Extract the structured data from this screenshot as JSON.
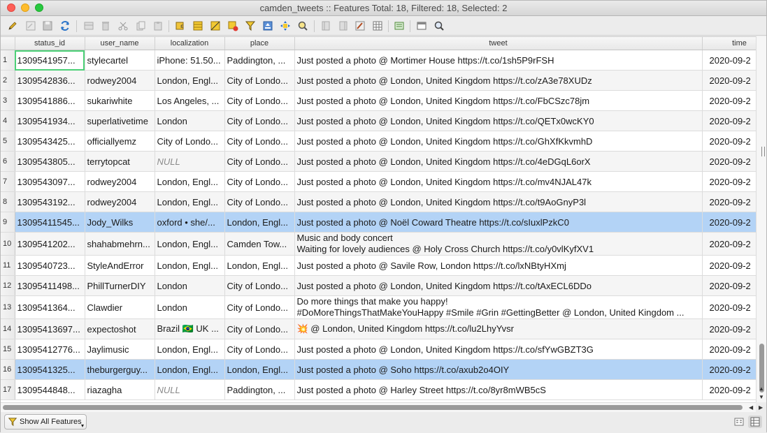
{
  "window": {
    "title": "camden_tweets :: Features Total: 18, Filtered: 18, Selected: 2"
  },
  "toolbar": {
    "icons": [
      "pencil-icon",
      "multi-edit-icon",
      "save-icon",
      "refresh-icon",
      "add-feature-icon",
      "delete-icon",
      "cut-icon",
      "copy-icon",
      "paste-icon",
      "expression-select-icon",
      "select-all-icon",
      "invert-selection-icon",
      "deselect-icon",
      "filter-selection-icon",
      "move-selection-top-icon",
      "pan-to-selection-icon",
      "zoom-to-selection-icon",
      "new-field-icon",
      "delete-field-icon",
      "field-calculator-icon",
      "conditional-format-icon",
      "actions-icon",
      "dock-icon",
      "dock2-icon"
    ]
  },
  "table": {
    "columns": [
      "status_id",
      "user_name",
      "localization",
      "place",
      "tweet",
      "time"
    ],
    "rows": [
      {
        "n": "1",
        "status_id": "1309541957...",
        "user_name": "stylecartel",
        "localization": "iPhone: 51.50...",
        "place": "Paddington, ...",
        "tweet": [
          "Just posted a photo @ Mortimer House https://t.co/1sh5P9rFSH"
        ],
        "time": "2020-09-2"
      },
      {
        "n": "2",
        "status_id": "1309542836...",
        "user_name": "rodwey2004",
        "localization": "London, Engl...",
        "place": "City of Londo...",
        "tweet": [
          "Just posted a photo @ London, United Kingdom https://t.co/zA3e78XUDz"
        ],
        "time": "2020-09-2"
      },
      {
        "n": "3",
        "status_id": "1309541886...",
        "user_name": "sukariwhite",
        "localization": "Los Angeles, ...",
        "place": "City of Londo...",
        "tweet": [
          "Just posted a photo @ London, United Kingdom https://t.co/FbCSzc78jm"
        ],
        "time": "2020-09-2"
      },
      {
        "n": "4",
        "status_id": "1309541934...",
        "user_name": "superlativetime",
        "localization": "London",
        "place": "City of Londo...",
        "tweet": [
          "Just posted a photo @ London, United Kingdom https://t.co/QETx0wcKY0"
        ],
        "time": "2020-09-2"
      },
      {
        "n": "5",
        "status_id": "1309543425...",
        "user_name": "officiallyemz",
        "localization": "City of Londo...",
        "place": "City of Londo...",
        "tweet": [
          "Just posted a photo @ London, United Kingdom https://t.co/GhXfKkvmhD"
        ],
        "time": "2020-09-2"
      },
      {
        "n": "6",
        "status_id": "1309543805...",
        "user_name": "terrytopcat",
        "localization": "NULL",
        "place": "City of Londo...",
        "tweet": [
          "Just posted a photo @ London, United Kingdom https://t.co/4eDGqL6orX"
        ],
        "time": "2020-09-2"
      },
      {
        "n": "7",
        "status_id": "1309543097...",
        "user_name": "rodwey2004",
        "localization": "London, Engl...",
        "place": "City of Londo...",
        "tweet": [
          "Just posted a photo @ London, United Kingdom https://t.co/mv4NJAL47k"
        ],
        "time": "2020-09-2"
      },
      {
        "n": "8",
        "status_id": "1309543192...",
        "user_name": "rodwey2004",
        "localization": "London, Engl...",
        "place": "City of Londo...",
        "tweet": [
          "Just posted a photo @ London, United Kingdom https://t.co/t9AoGnyP3l"
        ],
        "time": "2020-09-2"
      },
      {
        "n": "9",
        "status_id": "13095411545...",
        "user_name": "Jody_Wilks",
        "localization": "oxford • she/...",
        "place": "London, Engl...",
        "tweet": [
          "Just posted a photo @ Noël Coward Theatre https://t.co/sIuxlPzkC0"
        ],
        "time": "2020-09-2",
        "selected": true
      },
      {
        "n": "10",
        "status_id": "1309541202...",
        "user_name": "shahabmehrn...",
        "localization": "London, Engl...",
        "place": "Camden Tow...",
        "tweet": [
          "Music and body concert",
          "Waiting for lovely audiences @ Holy Cross Church https://t.co/y0vlKyfXV1"
        ],
        "time": "2020-09-2"
      },
      {
        "n": "11",
        "status_id": "1309540723...",
        "user_name": "StyleAndError",
        "localization": "London, Engl...",
        "place": "London, Engl...",
        "tweet": [
          "Just posted a photo @ Savile Row, London https://t.co/lxNBtyHXmj"
        ],
        "time": "2020-09-2"
      },
      {
        "n": "12",
        "status_id": "13095411498...",
        "user_name": "PhillTurnerDIY",
        "localization": "London",
        "place": "City of Londo...",
        "tweet": [
          "Just posted a photo @ London, United Kingdom https://t.co/tAxECL6DDo"
        ],
        "time": "2020-09-2"
      },
      {
        "n": "13",
        "status_id": "1309541364...",
        "user_name": "Clawdier",
        "localization": "London",
        "place": "City of Londo...",
        "tweet": [
          "Do more things that make you happy!",
          "#DoMoreThingsThatMakeYouHappy  #Smile #Grin #GettingBetter @ London, United Kingdom ..."
        ],
        "time": "2020-09-2"
      },
      {
        "n": "14",
        "status_id": "13095413697...",
        "user_name": "expectoshot",
        "localization": "Brazil 🇧🇷 UK ...",
        "place": "City of Londo...",
        "tweet": [
          "💥 @ London, United Kingdom https://t.co/lu2LhyYvsr"
        ],
        "time": "2020-09-2"
      },
      {
        "n": "15",
        "status_id": "13095412776...",
        "user_name": "Jaylimusic",
        "localization": "London, Engl...",
        "place": "City of Londo...",
        "tweet": [
          "Just posted a photo @ London, United Kingdom https://t.co/sfYwGBZT3G"
        ],
        "time": "2020-09-2"
      },
      {
        "n": "16",
        "status_id": "1309541325...",
        "user_name": "theburgerguy...",
        "localization": "London, Engl...",
        "place": "London, Engl...",
        "tweet": [
          "Just posted a photo @ Soho https://t.co/axub2o4OIY"
        ],
        "time": "2020-09-2",
        "selected": true
      },
      {
        "n": "17",
        "status_id": "1309544848...",
        "user_name": "riazagha",
        "localization": "NULL",
        "place": "Paddington, ...",
        "tweet": [
          "Just posted a photo @ Harley Street https://t.co/8yr8mWB5cS"
        ],
        "time": "2020-09-2"
      }
    ]
  },
  "bottom": {
    "filter_label": "Show All Features"
  }
}
